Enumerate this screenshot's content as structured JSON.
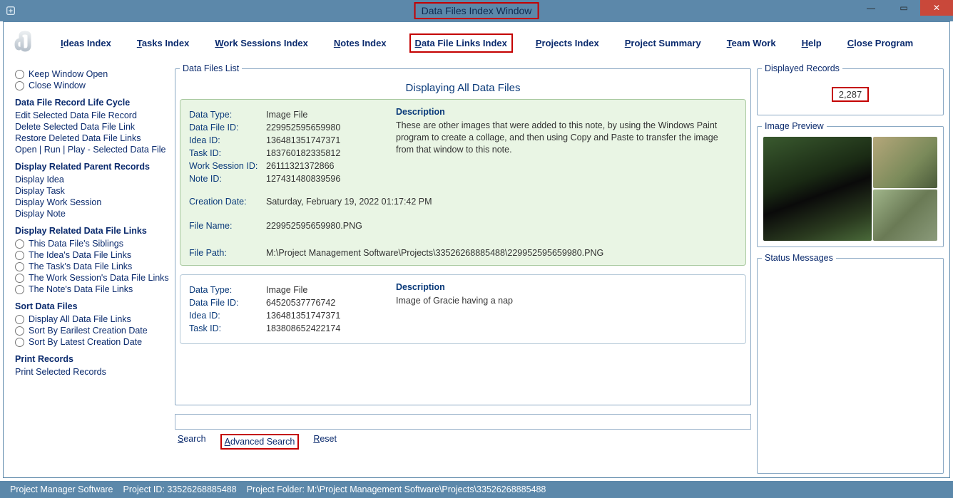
{
  "window": {
    "title": "Data Files Index Window"
  },
  "menu": {
    "ideas": "Ideas Index",
    "tasks": "Tasks Index",
    "work_sessions": "Work Sessions Index",
    "notes": "Notes Index",
    "data_file_links": "Data File Links Index",
    "projects": "Projects Index",
    "project_summary": "Project Summary",
    "team_work": "Team Work",
    "help": "Help",
    "close": "Close Program"
  },
  "sidebar": {
    "keep_open": "Keep Window Open",
    "close_win": "Close Window",
    "lifecycle_title": "Data File Record Life Cycle",
    "lifecycle": {
      "edit": "Edit Selected Data File Record",
      "delete": "Delete Selected Data File Link",
      "restore": "Restore Deleted Data File Links",
      "open_run": "Open | Run | Play - Selected Data File"
    },
    "parents_title": "Display Related Parent Records",
    "parents": {
      "idea": "Display Idea",
      "task": "Display Task",
      "ws": "Display Work Session",
      "note": "Display Note"
    },
    "related_title": "Display Related Data File Links",
    "related": {
      "siblings": "This Data File's Siblings",
      "idea": "The Idea's Data File Links",
      "task": "The Task's Data File Links",
      "ws": "The Work Session's Data File Links",
      "note": "The Note's Data File Links"
    },
    "sort_title": "Sort Data Files",
    "sort": {
      "all": "Display All Data File Links",
      "earliest": "Sort By Earilest Creation Date",
      "latest": "Sort By Latest Creation Date"
    },
    "print_title": "Print Records",
    "print_sel": "Print Selected Records"
  },
  "list": {
    "legend": "Data Files List",
    "heading": "Displaying All Data Files",
    "labels": {
      "data_type": "Data Type:",
      "data_file_id": "Data File ID:",
      "idea_id": "Idea ID:",
      "task_id": "Task ID:",
      "ws_id": "Work Session ID:",
      "note_id": "Note ID:",
      "creation": "Creation Date:",
      "file_name": "File Name:",
      "file_path": "File Path:",
      "description": "Description"
    },
    "records": [
      {
        "data_type": "Image File",
        "data_file_id": "229952595659980",
        "idea_id": "136481351747371",
        "task_id": "183760182335812",
        "ws_id": "26111321372866",
        "note_id": "127431480839596",
        "creation": "Saturday, February 19, 2022   01:17:42 PM",
        "file_name": "229952595659980.PNG",
        "file_path": "M:\\Project Management Software\\Projects\\33526268885488\\229952595659980.PNG",
        "description": "These are other images that were added to this note, by using the Windows Paint program to create a collage, and then using Copy and Paste to transfer the image from that window to this note."
      },
      {
        "data_type": "Image File",
        "data_file_id": "64520537776742",
        "idea_id": "136481351747371",
        "task_id": "183808652422174",
        "description": "Image of Gracie having a nap"
      }
    ]
  },
  "search": {
    "search": "Search",
    "advanced": "Advanced Search",
    "reset": "Reset"
  },
  "displayed_records": {
    "legend": "Displayed Records",
    "value": "2,287"
  },
  "image_preview": {
    "legend": "Image Preview"
  },
  "status_messages": {
    "legend": "Status Messages"
  },
  "statusbar": {
    "app": "Project Manager Software",
    "project_id_label": "Project ID:",
    "project_id": "33526268885488",
    "project_folder_label": "Project Folder:",
    "project_folder": "M:\\Project Management Software\\Projects\\33526268885488"
  }
}
